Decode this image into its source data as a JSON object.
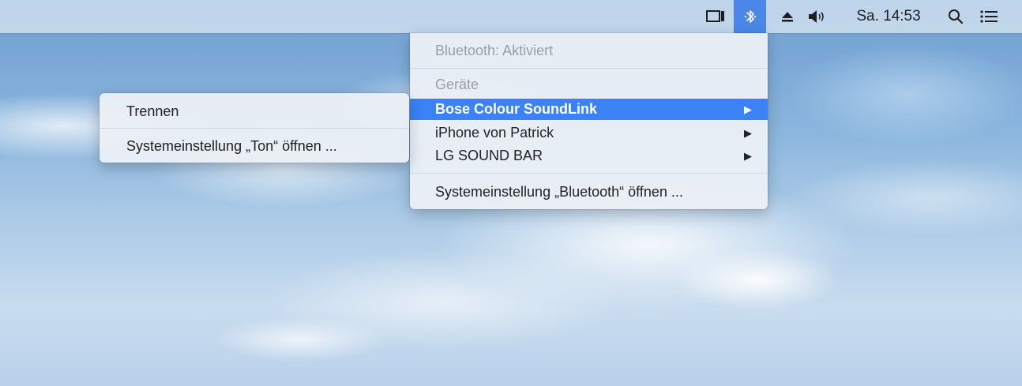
{
  "menubar": {
    "clock": "Sa. 14:53",
    "icons": {
      "display": "display-mirroring-icon",
      "bluetooth": "bluetooth-icon",
      "eject": "eject-icon",
      "volume": "volume-icon",
      "search": "spotlight-search-icon",
      "list": "notification-center-icon"
    },
    "active_color": "#4a87e8"
  },
  "bluetooth_menu": {
    "status": "Bluetooth: Aktiviert",
    "devices_header": "Geräte",
    "devices": [
      {
        "name": "Bose Colour SoundLink",
        "highlighted": true
      },
      {
        "name": "iPhone von Patrick",
        "highlighted": false
      },
      {
        "name": "LG SOUND BAR",
        "highlighted": false
      }
    ],
    "preferences": "Systemeinstellung „Bluetooth“ öffnen ...",
    "highlight_color": "#3b82f6"
  },
  "device_submenu": {
    "disconnect": "Trennen",
    "preferences": "Systemeinstellung „Ton“ öffnen ..."
  }
}
